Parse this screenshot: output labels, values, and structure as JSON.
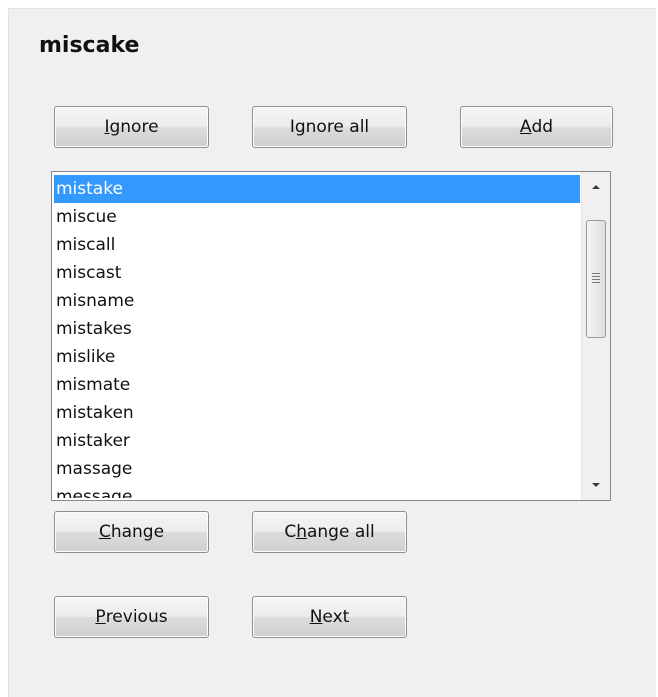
{
  "misspelled_word": "miscake",
  "actions": {
    "ignore": {
      "pre": "",
      "key": "I",
      "post": "gnore"
    },
    "ignore_all": {
      "pre": "I",
      "key": "g",
      "post": "nore all"
    },
    "add": {
      "pre": "",
      "key": "A",
      "post": "dd"
    },
    "change": {
      "pre": "",
      "key": "C",
      "post": "hange"
    },
    "change_all": {
      "pre": "C",
      "key": "h",
      "post": "ange all"
    },
    "previous": {
      "pre": "",
      "key": "P",
      "post": "revious"
    },
    "next": {
      "pre": "",
      "key": "N",
      "post": "ext"
    }
  },
  "suggestions": [
    "mistake",
    "miscue",
    "miscall",
    "miscast",
    "misname",
    "mistakes",
    "mislike",
    "mismate",
    "mistaken",
    "mistaker",
    "massage",
    "message"
  ],
  "selected_index": 0,
  "icons": {
    "scroll_up": "triangle-up-icon",
    "scroll_down": "triangle-down-icon",
    "thumb_grip": "grip-icon"
  },
  "colors": {
    "selection": "#3399ff",
    "panel_bg": "#f0f0f0"
  }
}
